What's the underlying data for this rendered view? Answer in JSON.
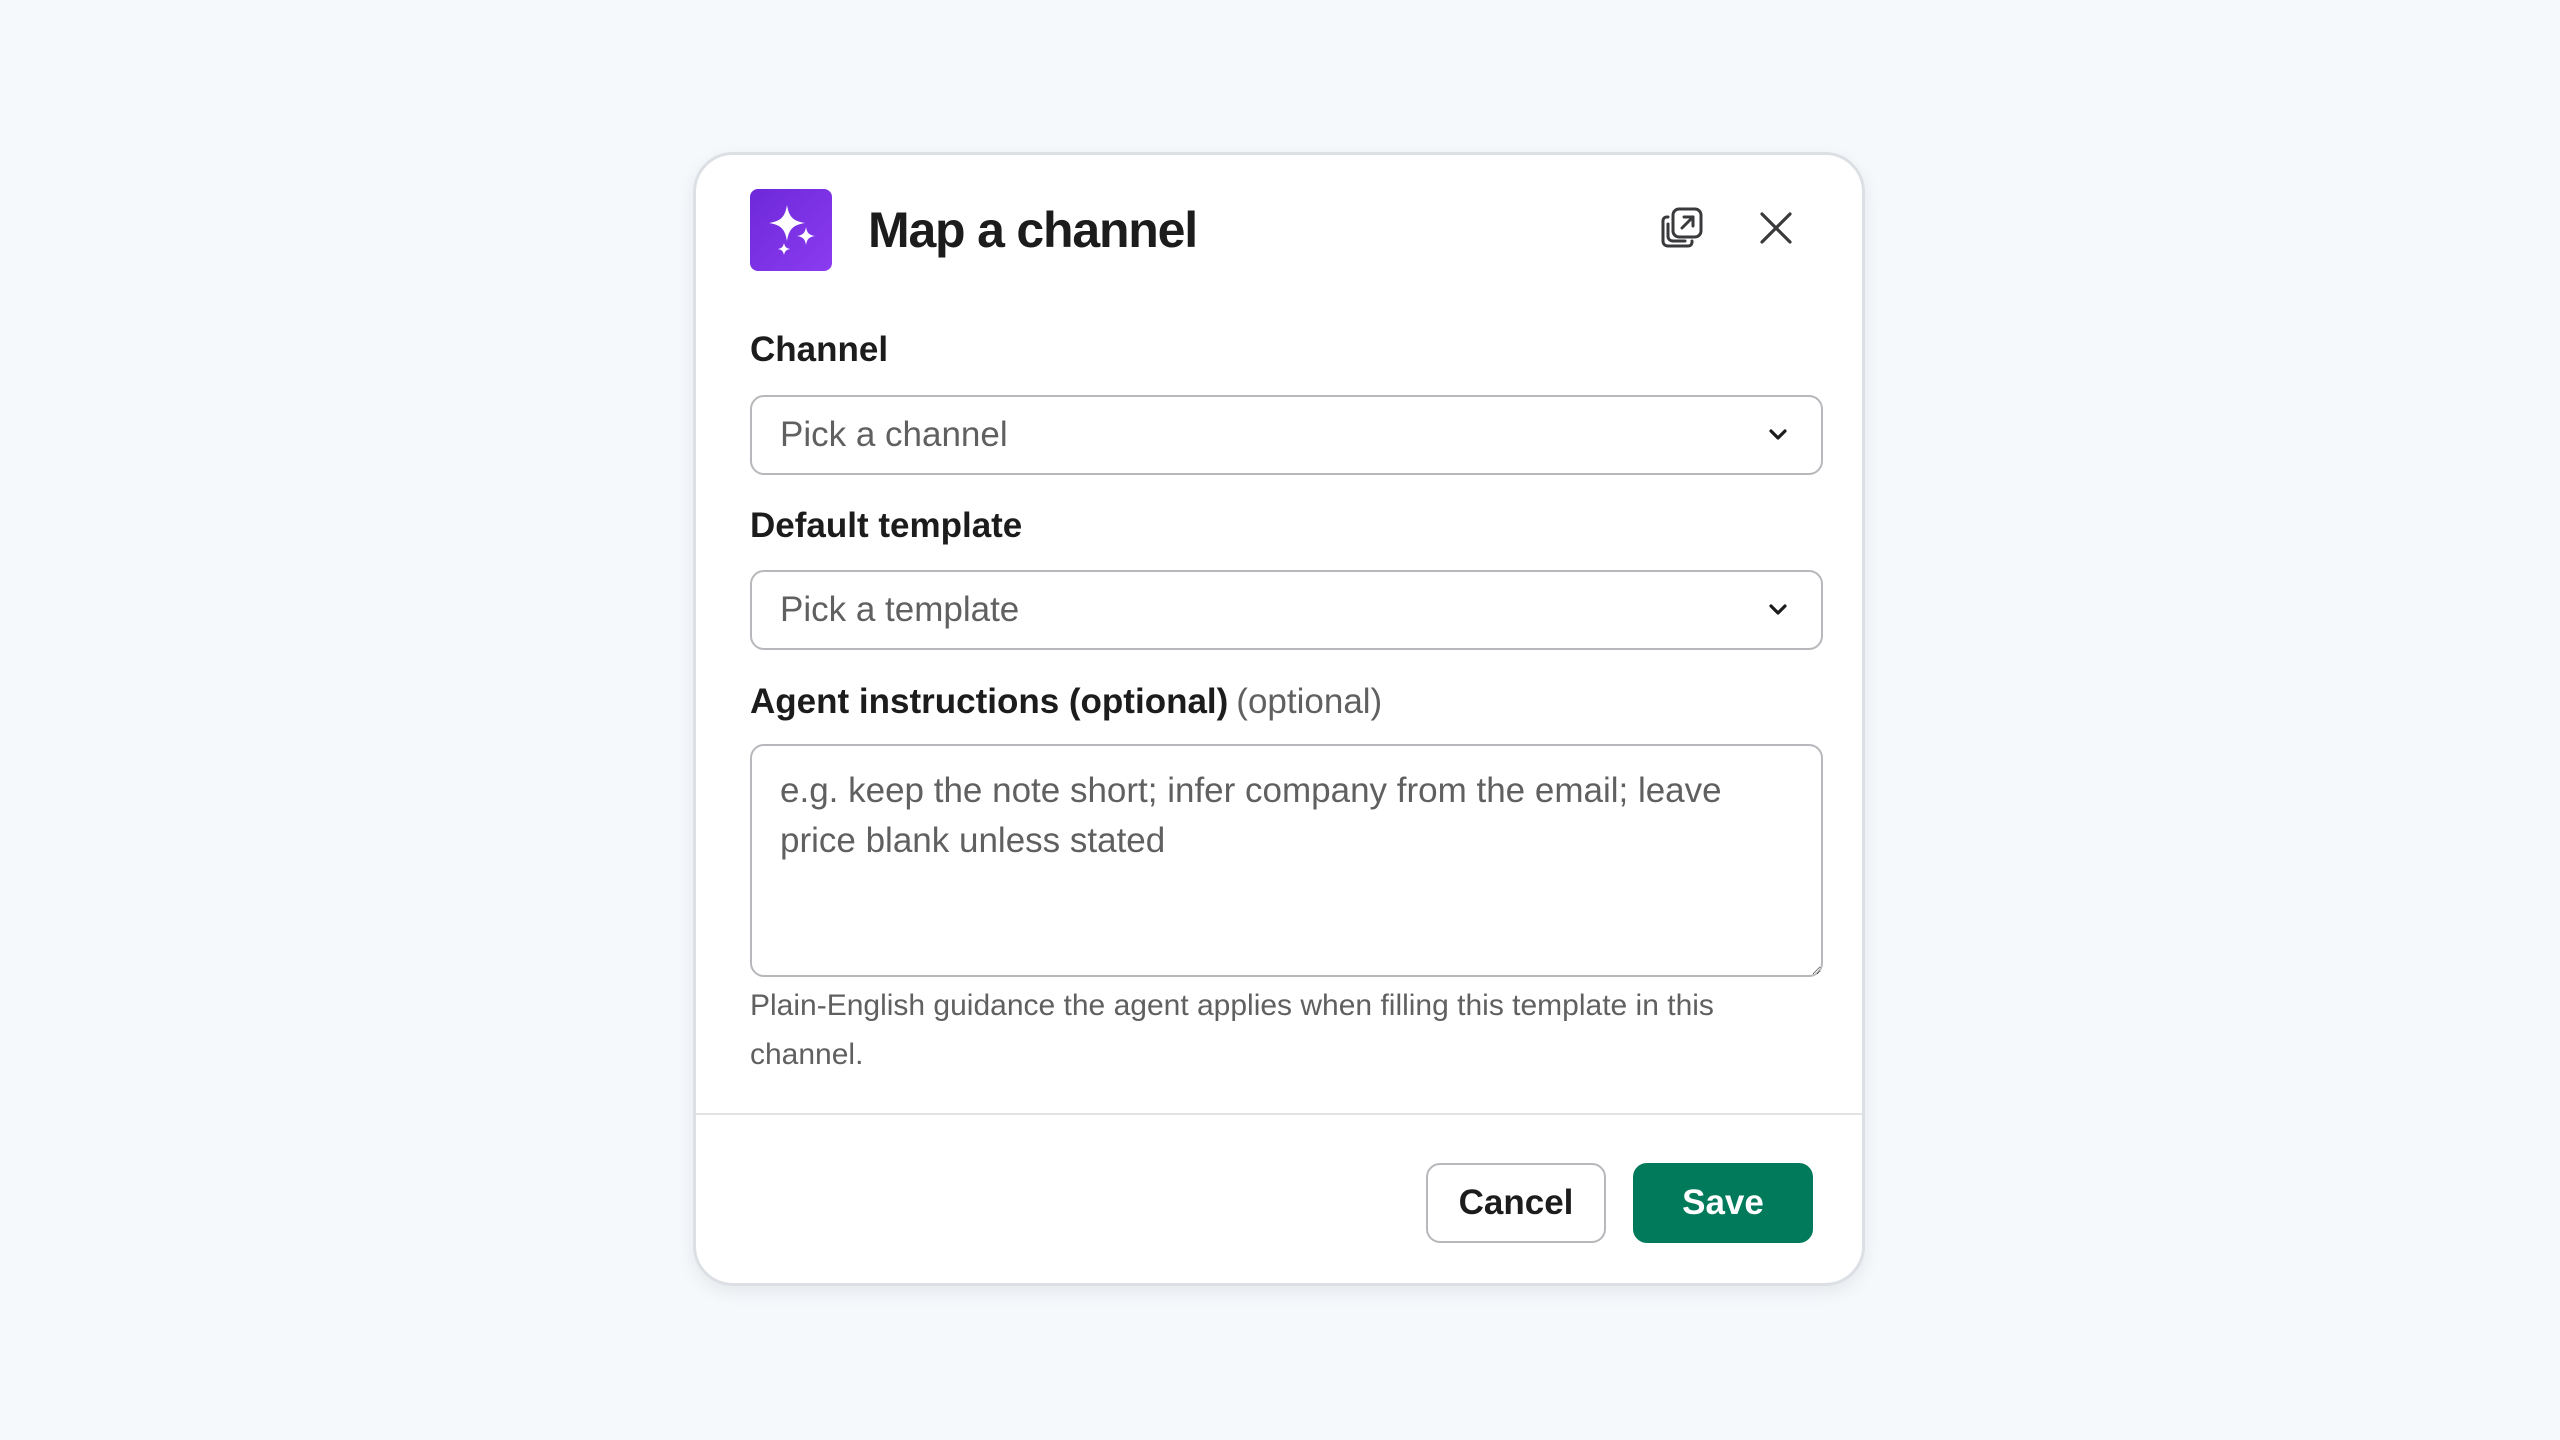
{
  "modal": {
    "title": "Map a channel",
    "app_icon": "sparkles-icon",
    "popout_icon": "popout-icon",
    "close_icon": "close-icon",
    "accent_color": "#7c3aed"
  },
  "channel_field": {
    "label": "Channel",
    "placeholder": "Pick a channel",
    "icon": "chevron-down-icon"
  },
  "template_field": {
    "label": "Default template",
    "placeholder": "Pick a template",
    "icon": "chevron-down-icon"
  },
  "instructions_field": {
    "label": "Agent instructions (optional)",
    "optional_hint": "(optional)",
    "placeholder": "e.g. keep the note short; infer company from the email; leave price blank unless stated",
    "value": "",
    "helper_text": "Plain-English guidance the agent applies when filling this template in this channel."
  },
  "footer": {
    "cancel_label": "Cancel",
    "save_label": "Save",
    "save_color": "#007a5a"
  }
}
